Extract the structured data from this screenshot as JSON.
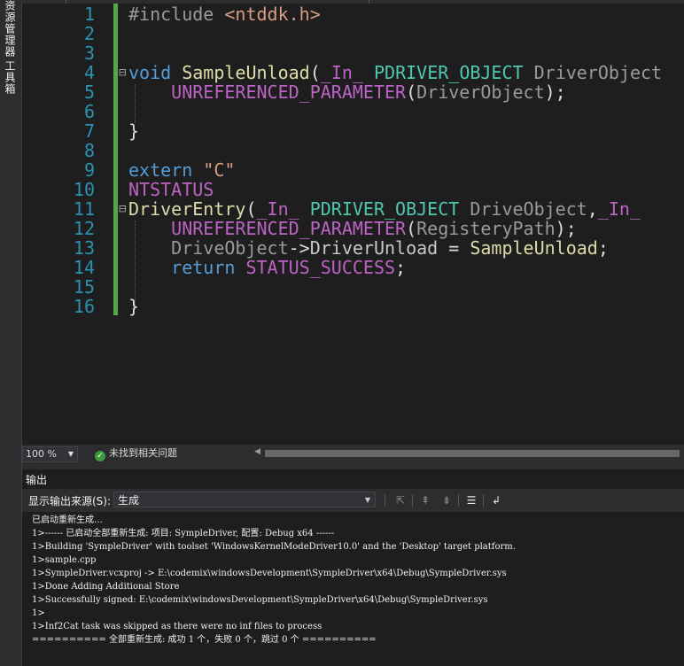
{
  "side_tabs": [
    "资源管理器",
    "工具箱"
  ],
  "code_lines": [
    {
      "n": "1"
    },
    {
      "n": "2"
    },
    {
      "n": "3"
    },
    {
      "n": "4"
    },
    {
      "n": "5"
    },
    {
      "n": "6"
    },
    {
      "n": "7"
    },
    {
      "n": "8"
    },
    {
      "n": "9"
    },
    {
      "n": "10"
    },
    {
      "n": "11"
    },
    {
      "n": "12"
    },
    {
      "n": "13"
    },
    {
      "n": "14"
    },
    {
      "n": "15"
    },
    {
      "n": "16"
    }
  ],
  "code": {
    "l1_directive": "#include ",
    "l1_header": "<ntddk.h>",
    "l4_void": "void ",
    "l4_fn": "SampleUnload",
    "l4_paren": "(",
    "l4_in": "_In_ ",
    "l4_type": "PDRIVER_OBJECT ",
    "l4_param": "DriverObject",
    "l5_macro": "UNREFERENCED_PARAMETER",
    "l5_open": "(",
    "l5_arg": "DriverObject",
    "l5_close": ");",
    "l7_brace": "}",
    "l9_extern": "extern ",
    "l9_str": "\"C\"",
    "l10_type": "NTSTATUS",
    "l11_fn": "DriverEntry",
    "l11_paren": "(",
    "l11_in": "_In_ ",
    "l11_type": "PDRIVER_OBJECT ",
    "l11_param": "DriveObject",
    "l11_comma": ",",
    "l11_in2": "_In_ ",
    "l12_macro": "UNREFERENCED_PARAMETER",
    "l12_open": "(",
    "l12_arg": "RegisteryPath",
    "l12_close": ");",
    "l13_obj": "DriveObject",
    "l13_arrow": "->",
    "l13_member": "DriverUnload",
    "l13_eq": " = ",
    "l13_fn": "SampleUnload",
    "l13_semi": ";",
    "l14_return": "return ",
    "l14_macro": "STATUS_SUCCESS",
    "l14_semi": ";",
    "l16_brace": "}",
    "fold_marker": "⊟"
  },
  "status": {
    "zoom": "100 %",
    "issues": "未找到相关问题"
  },
  "output": {
    "title": "输出",
    "source_label": "显示输出来源(S):",
    "source_value": "生成",
    "lines": [
      "已启动重新生成…",
      "1>------ 已启动全部重新生成: 项目: SympleDriver, 配置: Debug x64 ------",
      "1>Building 'SympleDriver' with toolset 'WindowsKernelModeDriver10.0' and the 'Desktop' target platform.",
      "1>sample.cpp",
      "1>SympleDriver.vcxproj -> E:\\codemix\\windowsDevelopment\\SympleDriver\\x64\\Debug\\SympleDriver.sys",
      "1>Done Adding Additional Store",
      "1>Successfully signed: E:\\codemix\\windowsDevelopment\\SympleDriver\\x64\\Debug\\SympleDriver.sys",
      "1>",
      "1>Inf2Cat task was skipped as there were no inf files to process",
      "========== 全部重新生成: 成功 1 个，失败 0 个，跳过 0 个 =========="
    ]
  }
}
